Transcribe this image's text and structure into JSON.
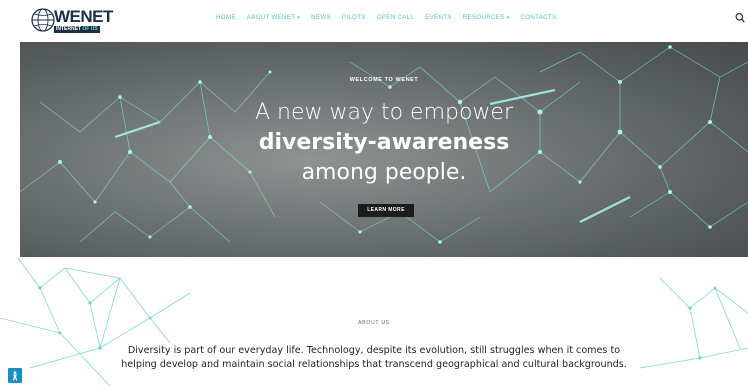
{
  "header": {
    "logo": {
      "wordmark": "WENET",
      "tagline_a": "INTERNET",
      "tagline_b": "OF US"
    },
    "nav": [
      {
        "label": "HOME",
        "dropdown": false
      },
      {
        "label": "ABOUT WENET",
        "dropdown": true
      },
      {
        "label": "NEWS",
        "dropdown": false
      },
      {
        "label": "PILOTS",
        "dropdown": false
      },
      {
        "label": "OPEN CALL",
        "dropdown": false
      },
      {
        "label": "EVENTS",
        "dropdown": false
      },
      {
        "label": "RESOURCES",
        "dropdown": true
      },
      {
        "label": "CONTACTS",
        "dropdown": false
      }
    ],
    "search_icon": "search-icon"
  },
  "hero": {
    "eyebrow": "WELCOME TO WENET",
    "line1": "A new way to empower",
    "line2": "diversity-awareness",
    "line3": "among people.",
    "button": "LEARN MORE"
  },
  "about": {
    "eyebrow": "ABOUT US",
    "text": "Diversity is part of our everyday life. Technology, despite its evolution, still struggles when it comes to helping develop and maintain social relationships that transcend geographical and cultural backgrounds."
  },
  "accessibility_icon": "accessibility-icon",
  "colors": {
    "accent": "#5ac1c8",
    "network": "#7fe3d6",
    "brand_dark": "#1f2f44",
    "button_dark": "#1c1c1c",
    "a11y_blue": "#1b8fbd"
  }
}
